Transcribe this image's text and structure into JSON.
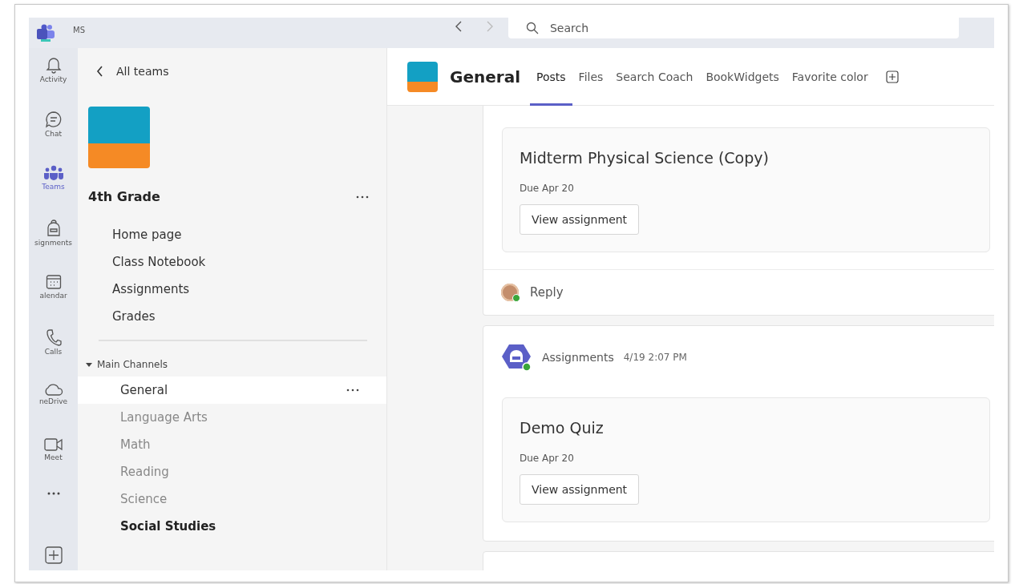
{
  "title_bar": {
    "account": "MS",
    "search": {
      "placeholder": "Search"
    }
  },
  "app_rail": [
    {
      "kind": "bell",
      "label": "Activity",
      "selected": false
    },
    {
      "kind": "chat",
      "label": "Chat",
      "selected": false
    },
    {
      "kind": "teams",
      "label": "Teams",
      "selected": true
    },
    {
      "kind": "backpack",
      "label": "signments",
      "selected": false
    },
    {
      "kind": "calendar",
      "label": "alendar",
      "selected": false
    },
    {
      "kind": "phone",
      "label": "Calls",
      "selected": false
    },
    {
      "kind": "cloud",
      "label": "neDrive",
      "selected": false
    },
    {
      "kind": "video",
      "label": "Meet",
      "selected": false
    }
  ],
  "sidebar": {
    "back_link": "All teams",
    "team_name": "4th Grade",
    "team_links": [
      "Home page",
      "Class Notebook",
      "Assignments",
      "Grades"
    ],
    "channel_group": {
      "label": "Main Channels",
      "expanded": true
    },
    "channels": [
      {
        "name": "General",
        "selected": true,
        "unread": false
      },
      {
        "name": "Language Arts",
        "selected": false,
        "unread": false
      },
      {
        "name": "Math",
        "selected": false,
        "unread": false
      },
      {
        "name": "Reading",
        "selected": false,
        "unread": false
      },
      {
        "name": "Science",
        "selected": false,
        "unread": false
      },
      {
        "name": "Social Studies",
        "selected": false,
        "unread": true
      }
    ]
  },
  "channel_header": {
    "name": "General",
    "tabs": [
      {
        "label": "Posts",
        "selected": true
      },
      {
        "label": "Files",
        "selected": false
      },
      {
        "label": "Search Coach",
        "selected": false
      },
      {
        "label": "BookWidgets",
        "selected": false
      },
      {
        "label": "Favorite color",
        "selected": false
      }
    ]
  },
  "posts": [
    {
      "kind": "continuation",
      "assignment": {
        "title": "Midterm Physical Science (Copy)",
        "due": "Due Apr 20",
        "button": "View assignment"
      },
      "reply": "Reply"
    },
    {
      "kind": "full",
      "author": "Assignments",
      "time": "4/19 2:07 PM",
      "assignment": {
        "title": "Demo Quiz",
        "due": "Due Apr 20",
        "button": "View assignment"
      }
    }
  ]
}
